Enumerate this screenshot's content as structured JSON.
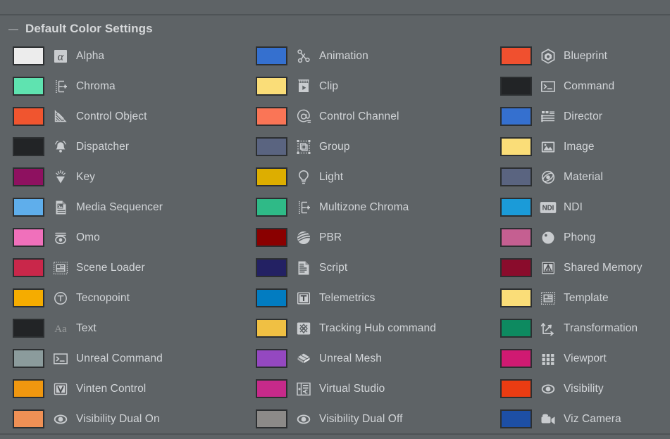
{
  "group": {
    "title": "Default Color Settings"
  },
  "colors": {
    "panel_bg": "#5e6366",
    "border": "#4e5356",
    "text": "#d2d5d8",
    "icon": "#c9cccf",
    "swatch_border": "#2c2f31"
  },
  "columns": [
    {
      "name": "column-1",
      "items": [
        {
          "label": "Alpha",
          "color": "#ececec",
          "icon": "alpha-icon"
        },
        {
          "label": "Chroma",
          "color": "#5fe3b0",
          "icon": "chroma-key-add-icon"
        },
        {
          "label": "Control Object",
          "color": "#f0552f",
          "icon": "control-object-fan-icon"
        },
        {
          "label": "Dispatcher",
          "color": "#222426",
          "icon": "bell-icon"
        },
        {
          "label": "Key",
          "color": "#8e1160",
          "icon": "key-spark-icon"
        },
        {
          "label": "Media Sequencer",
          "color": "#5faeeb",
          "icon": "media-document-icon"
        },
        {
          "label": "Omo",
          "color": "#f070bb",
          "icon": "omo-eye-icon"
        },
        {
          "label": "Scene Loader",
          "color": "#c9274a",
          "icon": "scene-loader-icon"
        },
        {
          "label": "Tecnopoint",
          "color": "#f5ac00",
          "icon": "tecnopoint-circle-t-icon"
        },
        {
          "label": "Text",
          "color": "#222426",
          "icon": "text-aa-icon"
        },
        {
          "label": "Unreal Command",
          "color": "#8b9b9c",
          "icon": "console-prompt-icon"
        },
        {
          "label": "Vinten Control",
          "color": "#f0970f",
          "icon": "vinten-v-icon"
        },
        {
          "label": "Visibility Dual On",
          "color": "#ef9055",
          "icon": "eye-filled-icon"
        }
      ]
    },
    {
      "name": "column-2",
      "items": [
        {
          "label": "Animation",
          "color": "#3570cf",
          "icon": "animation-nodes-icon"
        },
        {
          "label": "Clip",
          "color": "#fadd78",
          "icon": "clapperboard-icon"
        },
        {
          "label": "Control Channel",
          "color": "#fa7556",
          "icon": "at-channel-icon"
        },
        {
          "label": "Group",
          "color": "#5a6480",
          "icon": "group-frame-icon"
        },
        {
          "label": "Light",
          "color": "#ddae00",
          "icon": "light-bulb-icon"
        },
        {
          "label": "Multizone Chroma",
          "color": "#2fba87",
          "icon": "chroma-key-add-icon"
        },
        {
          "label": "PBR",
          "color": "#8a0000",
          "icon": "pbr-sphere-icon"
        },
        {
          "label": "Script",
          "color": "#232163",
          "icon": "script-document-icon"
        },
        {
          "label": "Telemetrics",
          "color": "#027cc1",
          "icon": "telemetrics-t-icon"
        },
        {
          "label": "Tracking Hub command",
          "color": "#f0c043",
          "icon": "tracking-hub-icon"
        },
        {
          "label": "Unreal Mesh",
          "color": "#9448c0",
          "icon": "unreal-mesh-icon"
        },
        {
          "label": "Virtual Studio",
          "color": "#c62a8a",
          "icon": "virtual-studio-icon"
        },
        {
          "label": "Visibility Dual Off",
          "color": "#8c8a88",
          "icon": "eye-filled-icon"
        }
      ]
    },
    {
      "name": "column-3",
      "items": [
        {
          "label": "Blueprint",
          "color": "#f0502f",
          "icon": "blueprint-hex-icon"
        },
        {
          "label": "Command",
          "color": "#222426",
          "icon": "console-prompt-icon"
        },
        {
          "label": "Director",
          "color": "#3570cf",
          "icon": "director-list-icon"
        },
        {
          "label": "Image",
          "color": "#fadd78",
          "icon": "image-icon"
        },
        {
          "label": "Material",
          "color": "#5a6480",
          "icon": "material-orbit-icon"
        },
        {
          "label": "NDI",
          "color": "#1b9bd8",
          "icon": "ndi-icon"
        },
        {
          "label": "Phong",
          "color": "#c55f91",
          "icon": "phong-sphere-icon"
        },
        {
          "label": "Shared Memory",
          "color": "#8a0c2c",
          "icon": "shared-memory-icon"
        },
        {
          "label": "Template",
          "color": "#fadd78",
          "icon": "template-icon"
        },
        {
          "label": "Transformation",
          "color": "#0d8a60",
          "icon": "transformation-axis-icon"
        },
        {
          "label": "Viewport",
          "color": "#d01a72",
          "icon": "viewport-grid-icon"
        },
        {
          "label": "Visibility",
          "color": "#ea3c12",
          "icon": "eye-filled-icon"
        },
        {
          "label": "Viz Camera",
          "color": "#1d4fa5",
          "icon": "video-camera-icon"
        }
      ]
    }
  ]
}
